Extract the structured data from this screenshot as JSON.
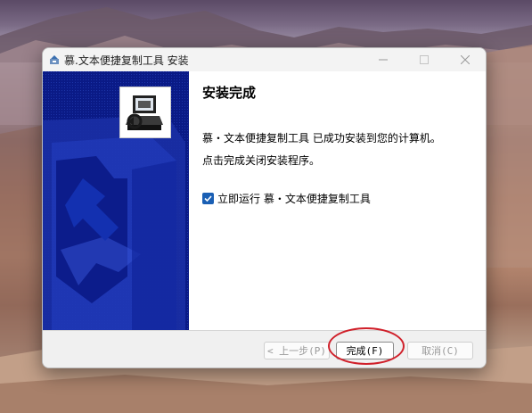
{
  "window": {
    "title": "慕.文本便捷复制工具 安装"
  },
  "content": {
    "heading": "安装完成",
    "line1": "慕・文本便捷复制工具 已成功安装到您的计算机。",
    "line2": "点击完成关闭安装程序。",
    "run_checkbox_label": "立即运行 慕・文本便捷复制工具",
    "run_checked": true
  },
  "buttons": {
    "back_label": "< 上一步(P)",
    "finish_label": "完成(F)",
    "cancel_label": "取消(C)"
  },
  "colors": {
    "banner_bg": "#0a1a86",
    "checkbox_accent": "#1a5fb4",
    "highlight_ellipse": "#d0202a"
  },
  "icons": {
    "app": "installer-icon",
    "minimize": "minimize-icon",
    "maximize": "maximize-icon",
    "close": "close-icon",
    "banner_logo": "installer-computer-logo",
    "checkmark": "checkmark-icon"
  }
}
